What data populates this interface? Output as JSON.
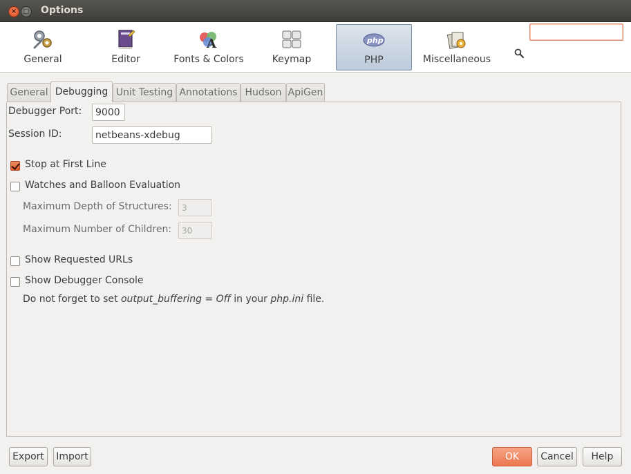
{
  "window": {
    "title": "Options"
  },
  "categories": [
    {
      "label": "General",
      "icon": "wrench-gears-icon"
    },
    {
      "label": "Editor",
      "icon": "editor-book-icon"
    },
    {
      "label": "Fonts & Colors",
      "icon": "fonts-colors-icon"
    },
    {
      "label": "Keymap",
      "icon": "keymap-keys-icon"
    },
    {
      "label": "PHP",
      "icon": "php-icon",
      "selected": true
    },
    {
      "label": "Miscellaneous",
      "icon": "miscellaneous-icon"
    }
  ],
  "search": {
    "value": "",
    "placeholder": ""
  },
  "tabs": [
    {
      "label": "General"
    },
    {
      "label": "Debugging",
      "active": true
    },
    {
      "label": "Unit Testing"
    },
    {
      "label": "Annotations"
    },
    {
      "label": "Hudson"
    },
    {
      "label": "ApiGen"
    }
  ],
  "debugging": {
    "debugger_port_label": "Debugger Port:",
    "debugger_port_value": "9000",
    "session_id_label": "Session ID:",
    "session_id_value": "netbeans-xdebug",
    "stop_first_line": {
      "label": "Stop at First Line",
      "checked": true
    },
    "watches": {
      "label": "Watches and Balloon Evaluation",
      "checked": false
    },
    "max_depth_label": "Maximum Depth of Structures:",
    "max_depth_value": "3",
    "max_children_label": "Maximum Number of Children:",
    "max_children_value": "30",
    "show_urls": {
      "label": "Show Requested URLs",
      "checked": false
    },
    "show_console": {
      "label": "Show Debugger Console",
      "checked": false
    },
    "note": {
      "part1": "Do not forget to set ",
      "code1": "output_buffering = Off",
      "part2": " in your ",
      "code2": "php.ini",
      "part3": " file."
    }
  },
  "buttons": {
    "export": "Export",
    "import": "Import",
    "ok": "OK",
    "cancel": "Cancel",
    "help": "Help"
  },
  "colors": {
    "accent": "#ec7850",
    "selected_category": "#c9d5e2"
  }
}
